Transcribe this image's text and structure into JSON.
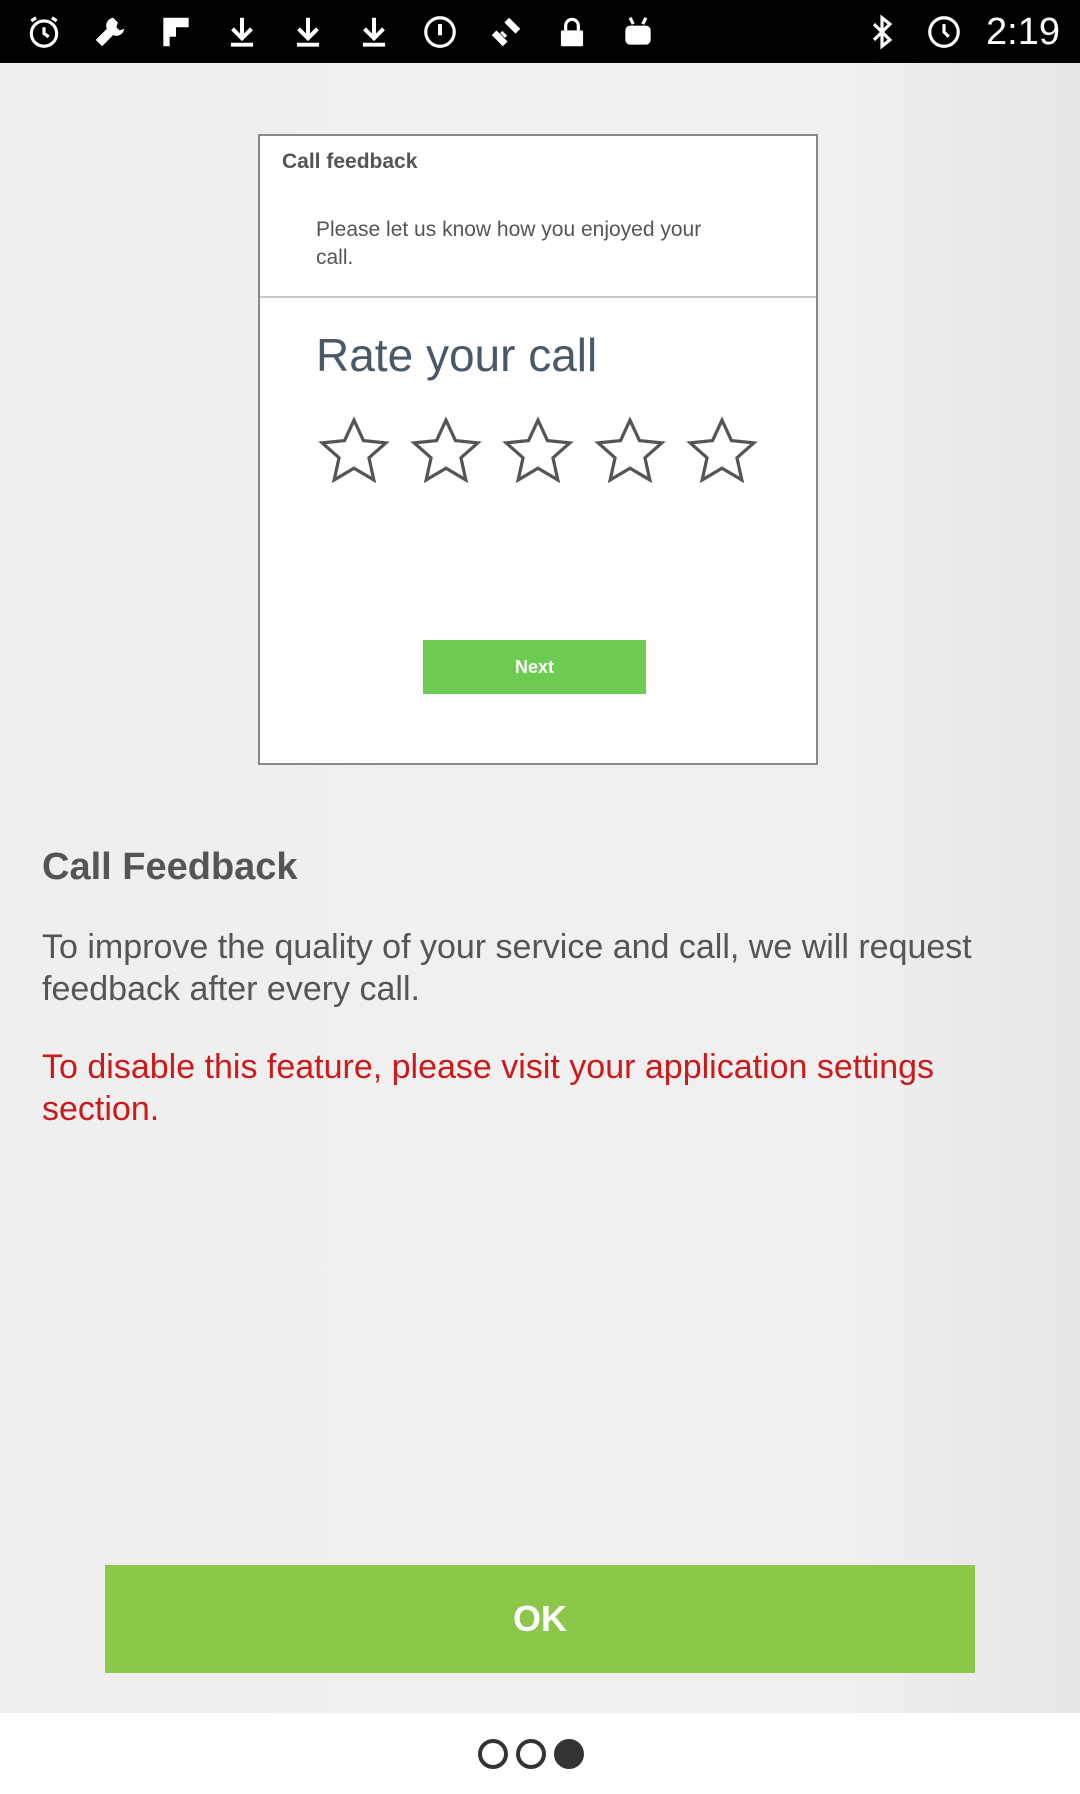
{
  "status_bar": {
    "time": "2:19",
    "left_icons": [
      "alarm-clock-icon",
      "wrench-icon",
      "flipboard-icon",
      "download-icon",
      "download-icon",
      "download-icon",
      "circle-info-icon",
      "fake-gps-icon",
      "lock-icon",
      "android-icon"
    ],
    "right_icons": [
      "bluetooth-icon",
      "alarm-icon"
    ]
  },
  "preview": {
    "title": "Call feedback",
    "subtitle": "Please let us know how you enjoyed your call.",
    "rate_label": "Rate your call",
    "stars": 5,
    "rating": 0,
    "next_label": "Next"
  },
  "content": {
    "heading": "Call Feedback",
    "body": "To improve the quality of your service and call, we will request feedback after every call.",
    "warning": "To disable this feature, please visit your application settings section."
  },
  "ok_label": "OK",
  "pager": {
    "count": 3,
    "active_index": 2
  },
  "colors": {
    "ok_button": "#8bc84a",
    "next_button": "#6dcb51",
    "warning_text": "#cc1a1a",
    "status_bar": "#000000"
  }
}
